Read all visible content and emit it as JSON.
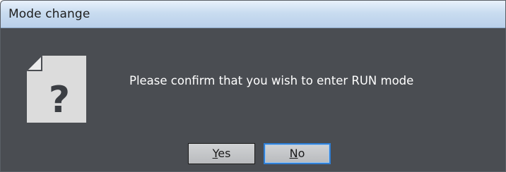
{
  "dialog": {
    "title": "Mode change",
    "icon": "question-document-icon",
    "message": "Please confirm that you wish to enter RUN mode",
    "buttons": {
      "yes": {
        "mnemonic": "Y",
        "rest": "es"
      },
      "no": {
        "mnemonic": "N",
        "rest": "o"
      }
    },
    "focused_button": "no"
  }
}
